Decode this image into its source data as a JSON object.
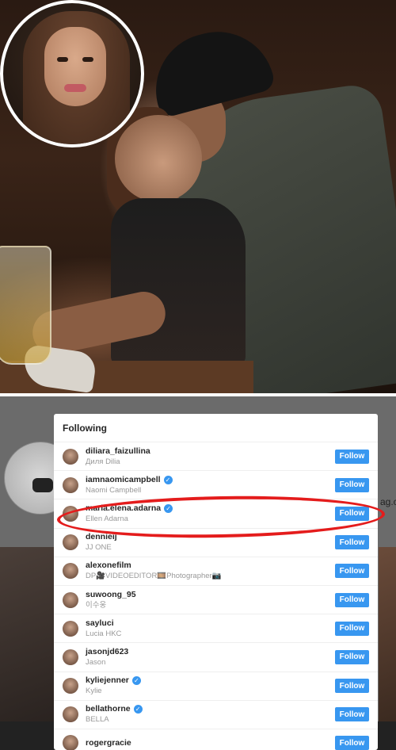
{
  "modal": {
    "title": "Following",
    "follow_label": "Follow",
    "users": [
      {
        "username": "diliara_faizullina",
        "full_name": "Диля Dilia",
        "verified": false,
        "highlighted": false
      },
      {
        "username": "iamnaomicampbell",
        "full_name": "Naomi Campbell",
        "verified": true,
        "highlighted": false
      },
      {
        "username": "maria.elena.adarna",
        "full_name": "Ellen Adarna",
        "verified": true,
        "highlighted": true
      },
      {
        "username": "dennieij",
        "full_name": "JJ ONE",
        "verified": false,
        "highlighted": false
      },
      {
        "username": "alexonefilm",
        "full_name": "DP🎥VIDEOEDITOR🎞️Photographer📷",
        "verified": false,
        "highlighted": false
      },
      {
        "username": "suwoong_95",
        "full_name": "이수웅",
        "verified": false,
        "highlighted": false
      },
      {
        "username": "sayluci",
        "full_name": "Lucia HKC",
        "verified": false,
        "highlighted": false
      },
      {
        "username": "jasonjd623",
        "full_name": "Jason",
        "verified": false,
        "highlighted": false
      },
      {
        "username": "kyliejenner",
        "full_name": "Kylie",
        "verified": true,
        "highlighted": false
      },
      {
        "username": "bellathorne",
        "full_name": "BELLA",
        "verified": true,
        "highlighted": false
      },
      {
        "username": "rogergracie",
        "full_name": "",
        "verified": false,
        "highlighted": false
      }
    ]
  },
  "background": {
    "partial_text": "ag.com"
  },
  "colors": {
    "accent": "#3897f0",
    "highlight_ring": "#e41c1c"
  }
}
